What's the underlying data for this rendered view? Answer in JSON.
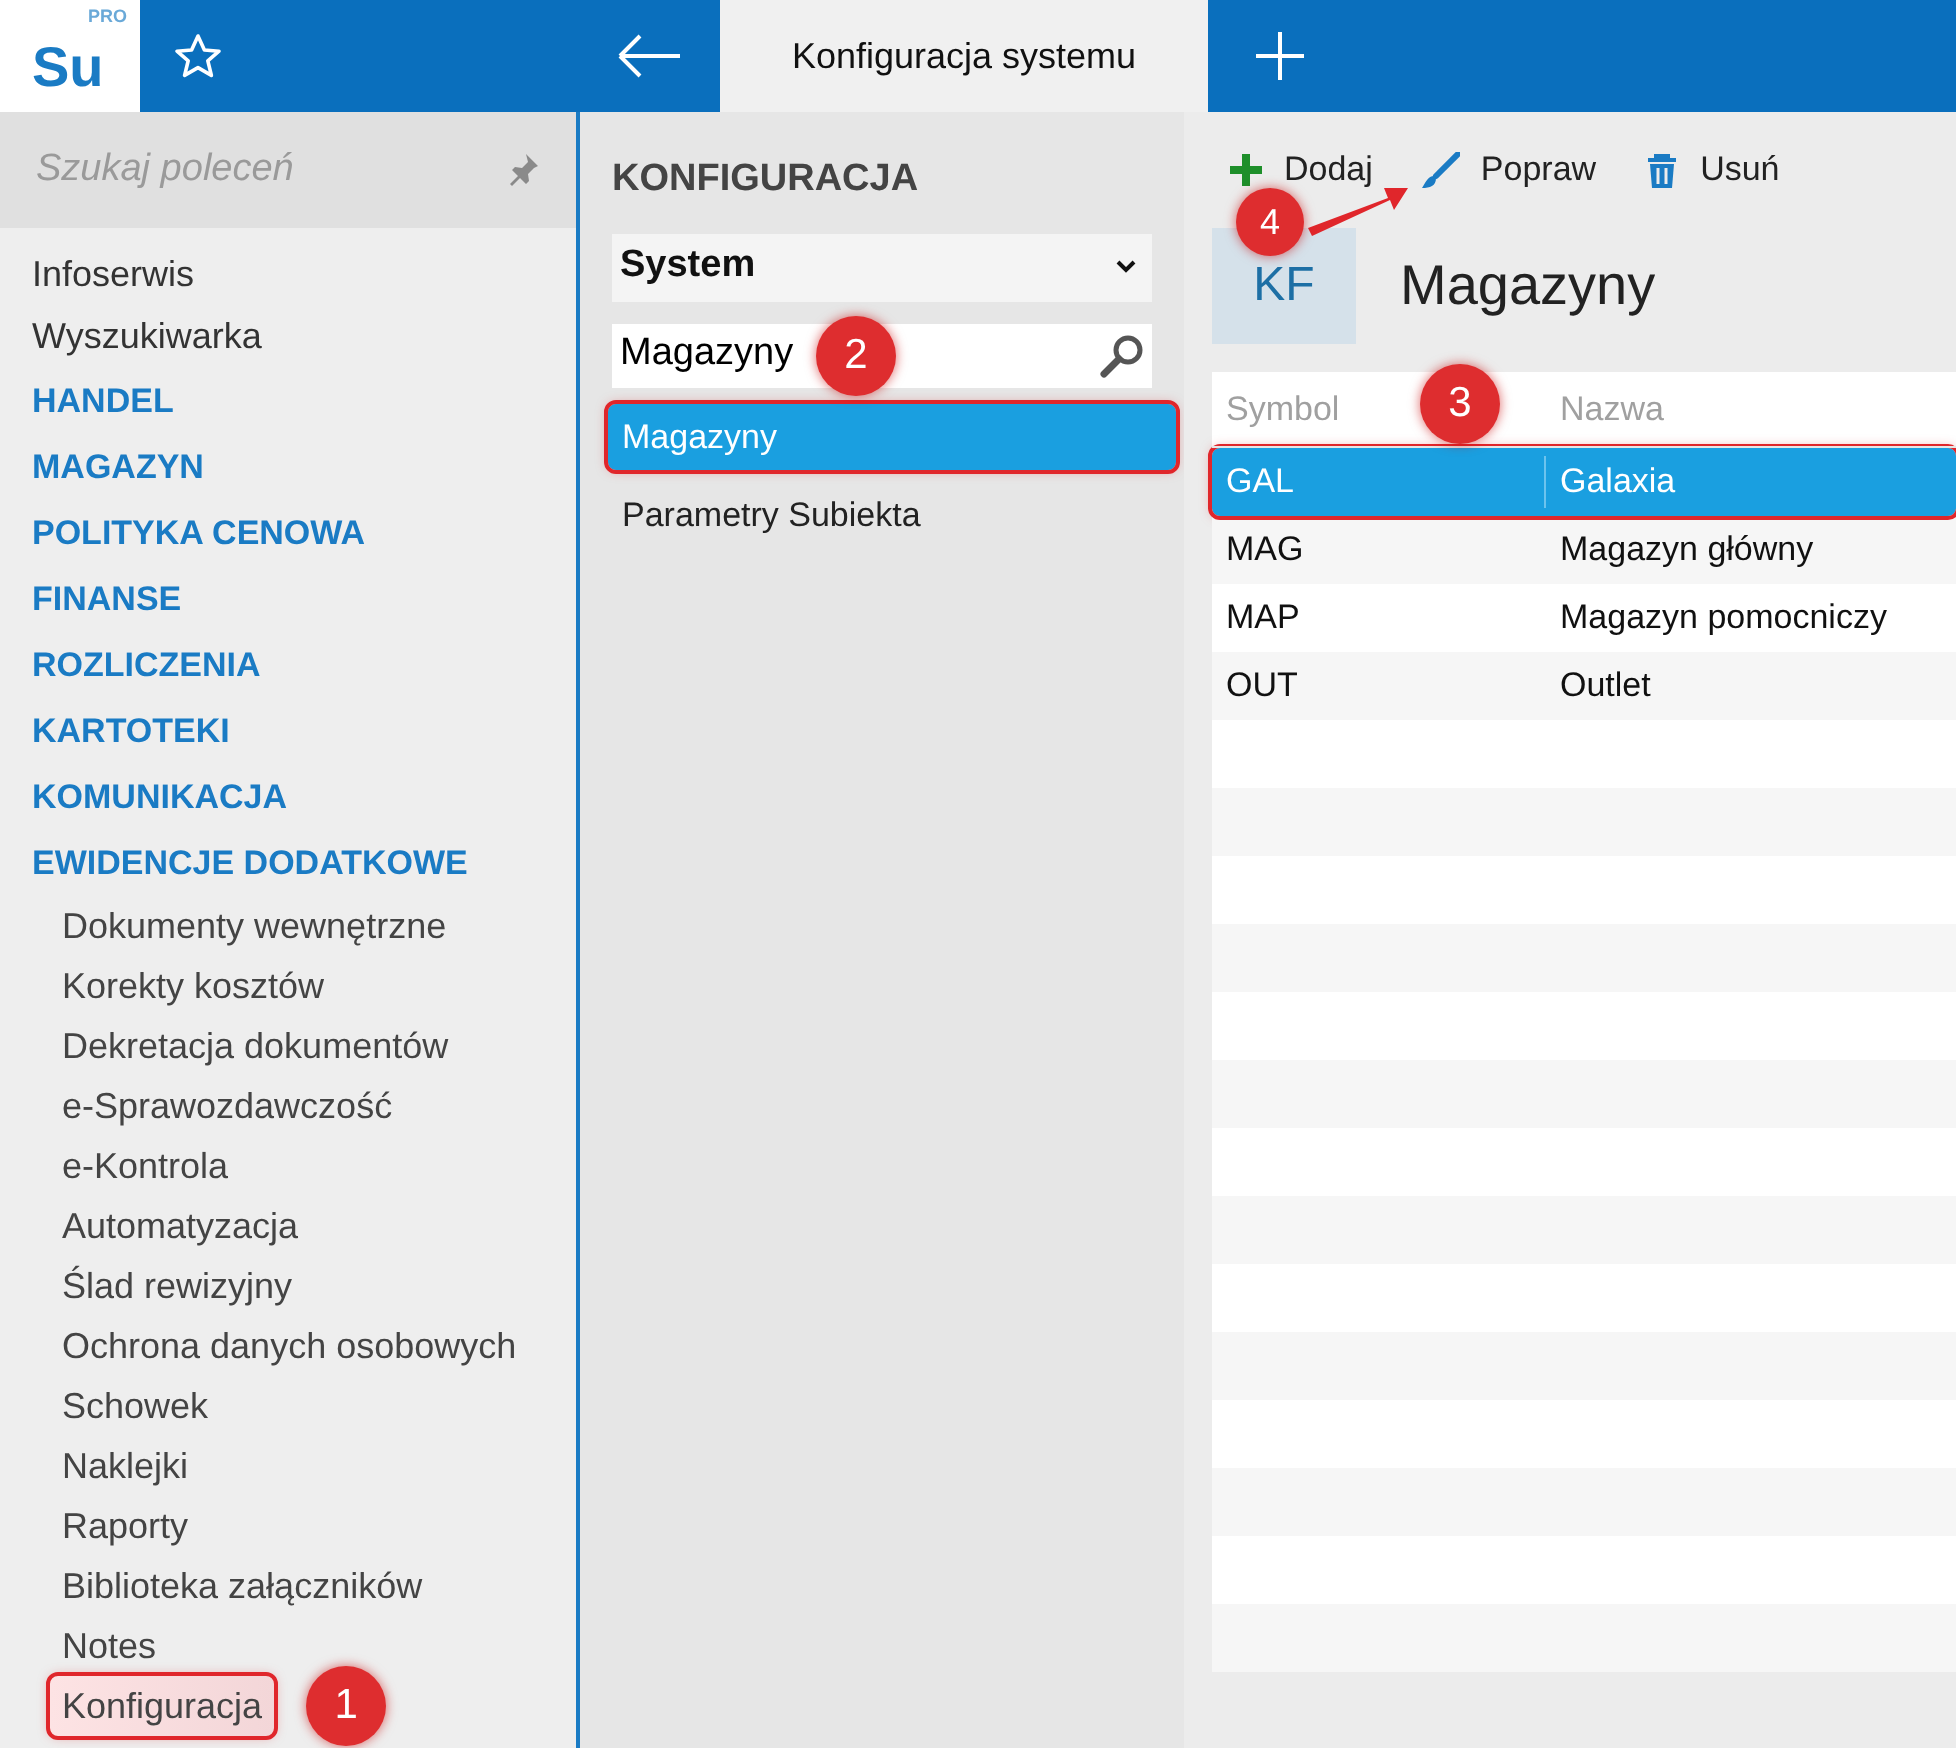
{
  "app": {
    "logo": "Su",
    "logo_badge": "PRO"
  },
  "tabs": [
    {
      "label": "Konfiguracja systemu",
      "selected": true
    }
  ],
  "sidebar": {
    "search": {
      "placeholder": "Szukaj poleceń"
    },
    "items": [
      {
        "label": "Infoserwis",
        "kind": "link"
      },
      {
        "label": "Wyszukiwarka",
        "kind": "link"
      },
      {
        "label": "HANDEL",
        "kind": "section"
      },
      {
        "label": "MAGAZYN",
        "kind": "section"
      },
      {
        "label": "POLITYKA CENOWA",
        "kind": "section"
      },
      {
        "label": "FINANSE",
        "kind": "section"
      },
      {
        "label": "ROZLICZENIA",
        "kind": "section"
      },
      {
        "label": "KARTOTEKI",
        "kind": "section"
      },
      {
        "label": "KOMUNIKACJA",
        "kind": "section"
      },
      {
        "label": "EWIDENCJE DODATKOWE",
        "kind": "section"
      },
      {
        "label": "Dokumenty wewnętrzne",
        "kind": "child"
      },
      {
        "label": "Korekty kosztów",
        "kind": "child"
      },
      {
        "label": "Dekretacja dokumentów",
        "kind": "child"
      },
      {
        "label": "e-Sprawozdawczość",
        "kind": "child"
      },
      {
        "label": "e-Kontrola",
        "kind": "child"
      },
      {
        "label": "Automatyzacja",
        "kind": "child"
      },
      {
        "label": "Ślad rewizyjny",
        "kind": "child"
      },
      {
        "label": "Ochrona danych osobowych",
        "kind": "child"
      },
      {
        "label": "Schowek",
        "kind": "child"
      },
      {
        "label": "Naklejki",
        "kind": "child"
      },
      {
        "label": "Raporty",
        "kind": "child"
      },
      {
        "label": "Biblioteka załączników",
        "kind": "child"
      },
      {
        "label": "Notes",
        "kind": "child"
      },
      {
        "label": "Konfiguracja",
        "kind": "child",
        "highlighted": true,
        "callout": "1"
      }
    ]
  },
  "config": {
    "title": "KONFIGURACJA",
    "dropdown": {
      "value": "System"
    },
    "search": {
      "value": "Magazyny",
      "callout": "2"
    },
    "items": [
      {
        "label": "Magazyny",
        "selected": true,
        "highlighted": true
      },
      {
        "label": "Parametry Subiekta",
        "selected": false,
        "highlighted": false
      }
    ]
  },
  "toolbar": {
    "buttons": [
      {
        "label": "Dodaj",
        "kind": "add"
      },
      {
        "label": "Popraw",
        "kind": "edit"
      },
      {
        "label": "Usuń",
        "kind": "delete"
      }
    ],
    "callout": {
      "number": "4",
      "arrow": true
    }
  },
  "panel": {
    "badge": "KF",
    "title": "Magazyny"
  },
  "table": {
    "columns": [
      "Symbol",
      "Nazwa"
    ],
    "callout": "3",
    "rows": [
      {
        "cells": [
          "GAL",
          "Galaxia"
        ],
        "selected": true,
        "highlighted": true
      },
      {
        "cells": [
          "MAG",
          "Magazyn główny"
        ],
        "selected": false,
        "highlighted": false
      },
      {
        "cells": [
          "MAP",
          "Magazyn pomocniczy"
        ],
        "selected": false,
        "highlighted": false
      },
      {
        "cells": [
          "OUT",
          "Outlet"
        ],
        "selected": false,
        "highlighted": false
      }
    ]
  }
}
